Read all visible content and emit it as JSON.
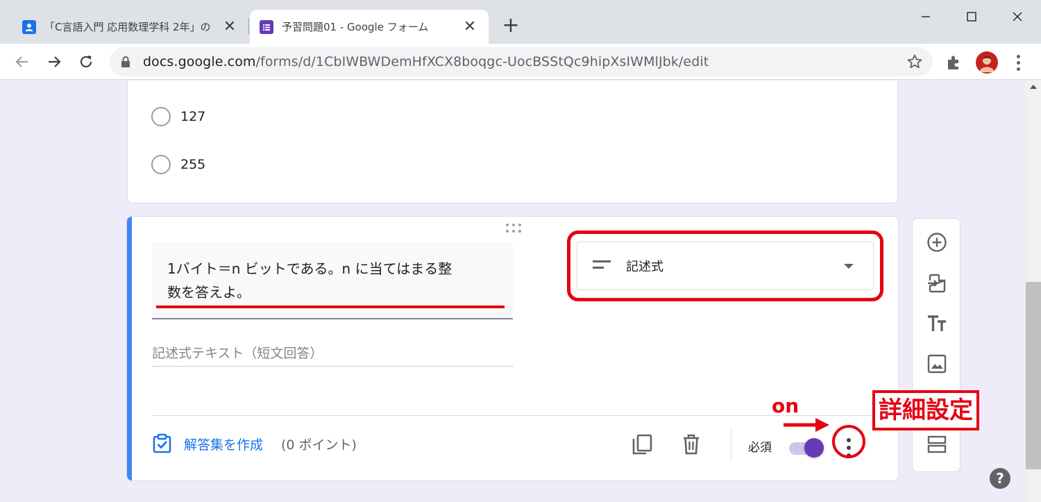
{
  "browser": {
    "tabs": [
      {
        "title": "「C言語入門 応用数理学科 2年」の",
        "favicon": "classroom-icon",
        "active": false
      },
      {
        "title": "予習問題01 - Google フォーム",
        "favicon": "forms-icon",
        "active": true
      }
    ],
    "new_tab_label": "+",
    "url_host": "docs.google.com",
    "url_path": "/forms/d/1CbIWBWDemHfXCX8boqgc-UocBSStQc9hipXsIWMlJbk/edit"
  },
  "previous_question": {
    "options": [
      "127",
      "255"
    ]
  },
  "question": {
    "title_line1": "1バイト＝n ビットである。n に当てはまる整",
    "title_line2": "数を答えよ。",
    "type_label": "記述式",
    "answer_placeholder": "記述式テキスト（短文回答）",
    "answer_key_label": "解答集を作成",
    "points_label": "(0 ポイント)",
    "required_label": "必須",
    "required_on": true
  },
  "side_toolbar": {
    "items": [
      "add-question-icon",
      "import-questions-icon",
      "add-title-icon",
      "add-image-icon",
      "add-video-icon",
      "add-section-icon"
    ]
  },
  "annotations": {
    "detail_settings": "詳細設定",
    "on_label": "on"
  },
  "colors": {
    "accent_blue": "#4285f4",
    "forms_purple": "#673ab7",
    "annotation_red": "#e60012",
    "page_background": "#f0ebf8"
  }
}
